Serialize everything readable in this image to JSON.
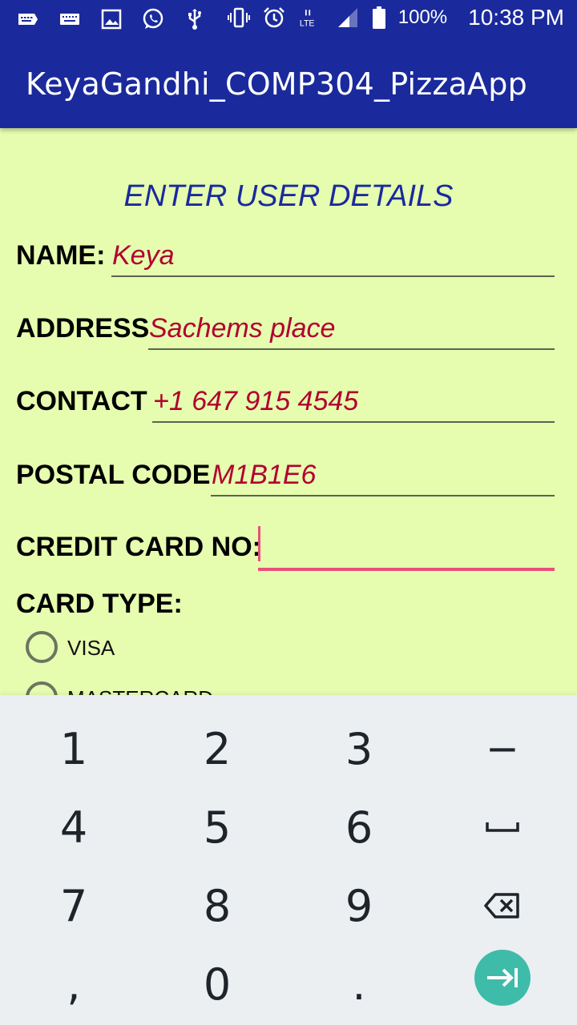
{
  "status_bar": {
    "left_icons": [
      "keyboard-notification-icon",
      "input-method-icon",
      "image-icon",
      "whatsapp-icon",
      "usb-icon"
    ],
    "right_icons": [
      "vibrate-icon",
      "alarm-icon",
      "lte-signal-icon",
      "cell-signal-icon",
      "battery-icon"
    ],
    "network": "LTE",
    "battery": "100%",
    "time": "10:38 PM"
  },
  "app_bar": {
    "title": "KeyaGandhi_COMP304_PizzaApp"
  },
  "form": {
    "heading": "ENTER USER DETAILS",
    "fields": [
      {
        "label": "NAME:",
        "value": "Keya"
      },
      {
        "label": "ADDRESS",
        "value": "Sachems place"
      },
      {
        "label": "CONTACT",
        "value": "+1 647 915 4545"
      },
      {
        "label": "POSTAL CODE",
        "value": "M1B1E6"
      },
      {
        "label": "CREDIT CARD NO:",
        "value": ""
      }
    ],
    "card_type_label": "CARD TYPE:",
    "card_types": [
      "VISA",
      "MASTERCARD"
    ]
  },
  "keyboard": {
    "rows": [
      [
        "1",
        "2",
        "3",
        "−"
      ],
      [
        "4",
        "5",
        "6",
        "space-icon"
      ],
      [
        "7",
        "8",
        "9",
        "backspace-icon"
      ],
      [
        ",",
        "0",
        ".",
        "next-icon"
      ]
    ],
    "accent_color": "#3fbba9"
  },
  "colors": {
    "app_bar": "#1a2a9c",
    "background": "#e6fcaf",
    "value_text": "#b0002f",
    "focus_underline": "#e8507a"
  }
}
